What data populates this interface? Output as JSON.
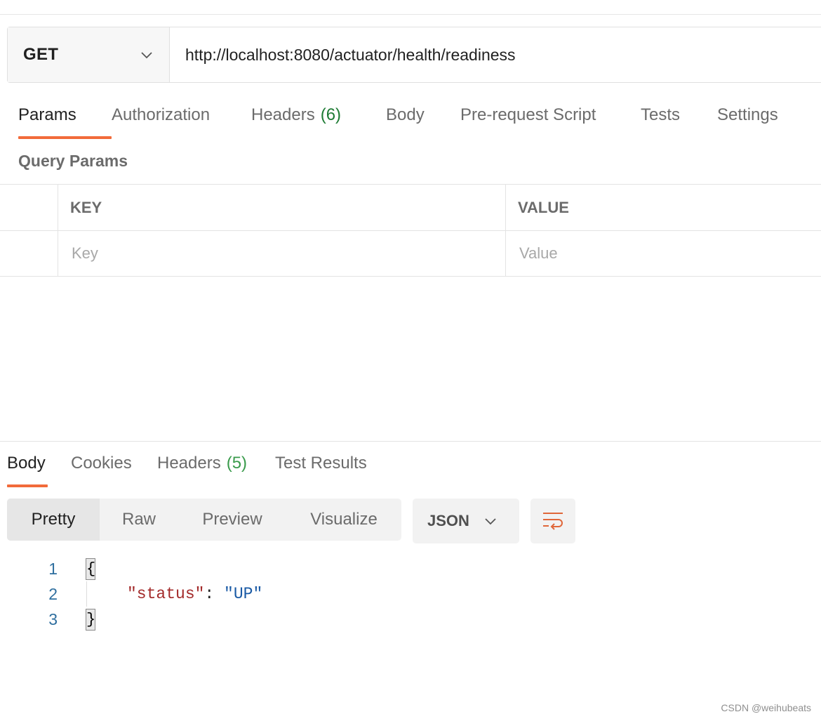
{
  "request": {
    "method": "GET",
    "url": "http://localhost:8080/actuator/health/readiness"
  },
  "request_tabs": [
    {
      "label": "Params",
      "active": true
    },
    {
      "label": "Authorization"
    },
    {
      "label": "Headers",
      "count": "(6)"
    },
    {
      "label": "Body"
    },
    {
      "label": "Pre-request Script"
    },
    {
      "label": "Tests"
    },
    {
      "label": "Settings"
    }
  ],
  "query_params": {
    "title": "Query Params",
    "key_header": "KEY",
    "value_header": "VALUE",
    "key_placeholder": "Key",
    "value_placeholder": "Value"
  },
  "response_tabs": [
    {
      "label": "Body",
      "active": true
    },
    {
      "label": "Cookies"
    },
    {
      "label": "Headers",
      "count": "(5)"
    },
    {
      "label": "Test Results"
    }
  ],
  "view_modes": [
    "Pretty",
    "Raw",
    "Preview",
    "Visualize"
  ],
  "format": "JSON",
  "code": {
    "line_numbers": [
      "1",
      "2",
      "3"
    ],
    "open_brace": "{",
    "close_brace": "}",
    "key": "\"status\"",
    "colon": ": ",
    "value": "\"UP\""
  },
  "watermark": "CSDN @weihubeats",
  "colors": {
    "accent": "#f26b3a",
    "count_green": "#1e7b34",
    "json_key": "#a32a2a",
    "json_value": "#1a5aa5"
  }
}
